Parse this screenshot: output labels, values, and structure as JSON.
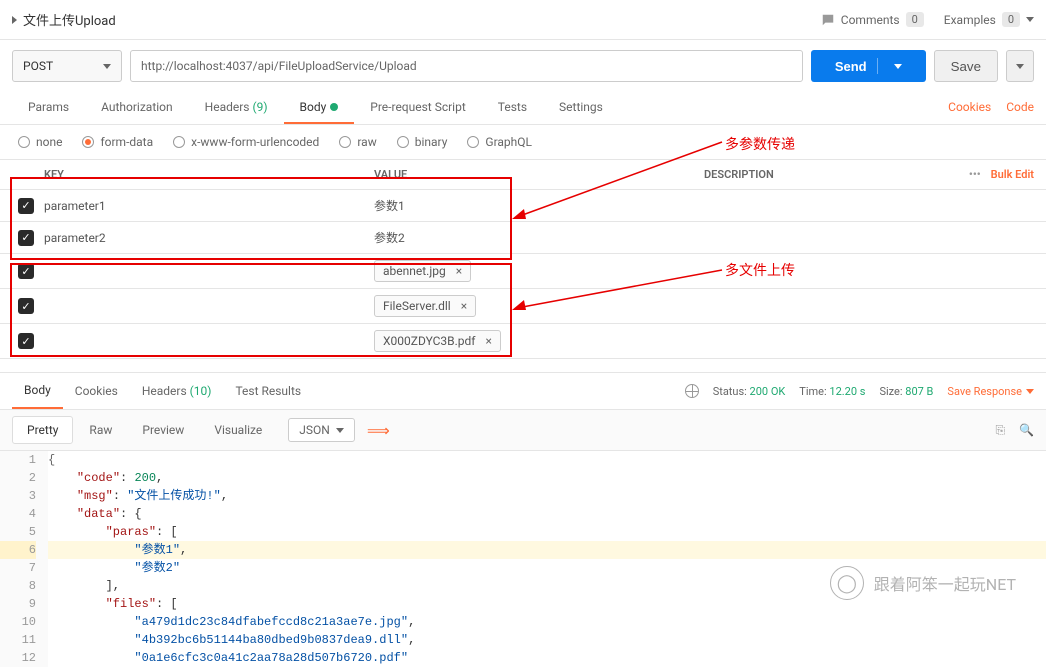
{
  "header": {
    "title": "文件上传Upload",
    "comments_label": "Comments",
    "comments_count": "0",
    "examples_label": "Examples",
    "examples_count": "0"
  },
  "request": {
    "method": "POST",
    "url": "http://localhost:4037/api/FileUploadService/Upload",
    "send_label": "Send",
    "save_label": "Save"
  },
  "tabs": {
    "params": "Params",
    "authorization": "Authorization",
    "headers": "Headers",
    "headers_count": "(9)",
    "body": "Body",
    "prerequest": "Pre-request Script",
    "tests": "Tests",
    "settings": "Settings",
    "cookies": "Cookies",
    "code": "Code"
  },
  "body_types": {
    "none": "none",
    "formdata": "form-data",
    "urlencoded": "x-www-form-urlencoded",
    "raw": "raw",
    "binary": "binary",
    "graphql": "GraphQL"
  },
  "table": {
    "key_header": "KEY",
    "value_header": "VALUE",
    "desc_header": "DESCRIPTION",
    "dots": "•••",
    "bulk_edit": "Bulk Edit",
    "rows": [
      {
        "key": "parameter1",
        "value": "参数1",
        "is_file": false
      },
      {
        "key": "parameter2",
        "value": "参数2",
        "is_file": false
      },
      {
        "key": "",
        "value": "abennet.jpg",
        "is_file": true
      },
      {
        "key": "",
        "value": "FileServer.dll",
        "is_file": true
      },
      {
        "key": "",
        "value": "X000ZDYC3B.pdf",
        "is_file": true
      }
    ]
  },
  "annotations": {
    "multi_param": "多参数传递",
    "multi_file": "多文件上传"
  },
  "response": {
    "tabs": {
      "body": "Body",
      "cookies": "Cookies",
      "headers": "Headers",
      "headers_count": "(10)",
      "test_results": "Test Results"
    },
    "status_label": "Status:",
    "status_value": "200 OK",
    "time_label": "Time:",
    "time_value": "12.20 s",
    "size_label": "Size:",
    "size_value": "807 B",
    "save_response": "Save Response"
  },
  "viewer": {
    "pretty": "Pretty",
    "raw": "Raw",
    "preview": "Preview",
    "visualize": "Visualize",
    "format": "JSON"
  },
  "response_body": {
    "code_key": "\"code\"",
    "code_val": "200",
    "msg_key": "\"msg\"",
    "msg_val": "\"文件上传成功!\"",
    "data_key": "\"data\"",
    "paras_key": "\"paras\"",
    "para1": "\"参数1\"",
    "para2": "\"参数2\"",
    "files_key": "\"files\"",
    "file1": "\"a479d1dc23c84dfabefccd8c21a3ae7e.jpg\"",
    "file2": "\"4b392bc6b51144ba80dbed9b0837dea9.dll\"",
    "file3": "\"0a1e6cfc3c0a41c2aa78a28d507b6720.pdf\""
  },
  "watermark": "跟着阿笨一起玩NET"
}
